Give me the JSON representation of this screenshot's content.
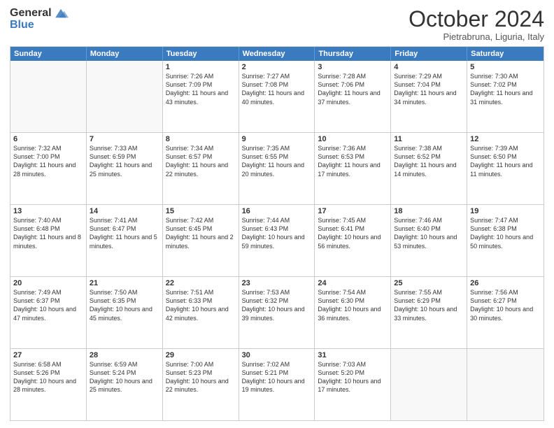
{
  "header": {
    "logo_general": "General",
    "logo_blue": "Blue",
    "title": "October 2024",
    "location": "Pietrabruna, Liguria, Italy"
  },
  "days_of_week": [
    "Sunday",
    "Monday",
    "Tuesday",
    "Wednesday",
    "Thursday",
    "Friday",
    "Saturday"
  ],
  "weeks": [
    [
      {
        "day": "",
        "text": ""
      },
      {
        "day": "",
        "text": ""
      },
      {
        "day": "1",
        "text": "Sunrise: 7:26 AM\nSunset: 7:09 PM\nDaylight: 11 hours and 43 minutes."
      },
      {
        "day": "2",
        "text": "Sunrise: 7:27 AM\nSunset: 7:08 PM\nDaylight: 11 hours and 40 minutes."
      },
      {
        "day": "3",
        "text": "Sunrise: 7:28 AM\nSunset: 7:06 PM\nDaylight: 11 hours and 37 minutes."
      },
      {
        "day": "4",
        "text": "Sunrise: 7:29 AM\nSunset: 7:04 PM\nDaylight: 11 hours and 34 minutes."
      },
      {
        "day": "5",
        "text": "Sunrise: 7:30 AM\nSunset: 7:02 PM\nDaylight: 11 hours and 31 minutes."
      }
    ],
    [
      {
        "day": "6",
        "text": "Sunrise: 7:32 AM\nSunset: 7:00 PM\nDaylight: 11 hours and 28 minutes."
      },
      {
        "day": "7",
        "text": "Sunrise: 7:33 AM\nSunset: 6:59 PM\nDaylight: 11 hours and 25 minutes."
      },
      {
        "day": "8",
        "text": "Sunrise: 7:34 AM\nSunset: 6:57 PM\nDaylight: 11 hours and 22 minutes."
      },
      {
        "day": "9",
        "text": "Sunrise: 7:35 AM\nSunset: 6:55 PM\nDaylight: 11 hours and 20 minutes."
      },
      {
        "day": "10",
        "text": "Sunrise: 7:36 AM\nSunset: 6:53 PM\nDaylight: 11 hours and 17 minutes."
      },
      {
        "day": "11",
        "text": "Sunrise: 7:38 AM\nSunset: 6:52 PM\nDaylight: 11 hours and 14 minutes."
      },
      {
        "day": "12",
        "text": "Sunrise: 7:39 AM\nSunset: 6:50 PM\nDaylight: 11 hours and 11 minutes."
      }
    ],
    [
      {
        "day": "13",
        "text": "Sunrise: 7:40 AM\nSunset: 6:48 PM\nDaylight: 11 hours and 8 minutes."
      },
      {
        "day": "14",
        "text": "Sunrise: 7:41 AM\nSunset: 6:47 PM\nDaylight: 11 hours and 5 minutes."
      },
      {
        "day": "15",
        "text": "Sunrise: 7:42 AM\nSunset: 6:45 PM\nDaylight: 11 hours and 2 minutes."
      },
      {
        "day": "16",
        "text": "Sunrise: 7:44 AM\nSunset: 6:43 PM\nDaylight: 10 hours and 59 minutes."
      },
      {
        "day": "17",
        "text": "Sunrise: 7:45 AM\nSunset: 6:41 PM\nDaylight: 10 hours and 56 minutes."
      },
      {
        "day": "18",
        "text": "Sunrise: 7:46 AM\nSunset: 6:40 PM\nDaylight: 10 hours and 53 minutes."
      },
      {
        "day": "19",
        "text": "Sunrise: 7:47 AM\nSunset: 6:38 PM\nDaylight: 10 hours and 50 minutes."
      }
    ],
    [
      {
        "day": "20",
        "text": "Sunrise: 7:49 AM\nSunset: 6:37 PM\nDaylight: 10 hours and 47 minutes."
      },
      {
        "day": "21",
        "text": "Sunrise: 7:50 AM\nSunset: 6:35 PM\nDaylight: 10 hours and 45 minutes."
      },
      {
        "day": "22",
        "text": "Sunrise: 7:51 AM\nSunset: 6:33 PM\nDaylight: 10 hours and 42 minutes."
      },
      {
        "day": "23",
        "text": "Sunrise: 7:53 AM\nSunset: 6:32 PM\nDaylight: 10 hours and 39 minutes."
      },
      {
        "day": "24",
        "text": "Sunrise: 7:54 AM\nSunset: 6:30 PM\nDaylight: 10 hours and 36 minutes."
      },
      {
        "day": "25",
        "text": "Sunrise: 7:55 AM\nSunset: 6:29 PM\nDaylight: 10 hours and 33 minutes."
      },
      {
        "day": "26",
        "text": "Sunrise: 7:56 AM\nSunset: 6:27 PM\nDaylight: 10 hours and 30 minutes."
      }
    ],
    [
      {
        "day": "27",
        "text": "Sunrise: 6:58 AM\nSunset: 5:26 PM\nDaylight: 10 hours and 28 minutes."
      },
      {
        "day": "28",
        "text": "Sunrise: 6:59 AM\nSunset: 5:24 PM\nDaylight: 10 hours and 25 minutes."
      },
      {
        "day": "29",
        "text": "Sunrise: 7:00 AM\nSunset: 5:23 PM\nDaylight: 10 hours and 22 minutes."
      },
      {
        "day": "30",
        "text": "Sunrise: 7:02 AM\nSunset: 5:21 PM\nDaylight: 10 hours and 19 minutes."
      },
      {
        "day": "31",
        "text": "Sunrise: 7:03 AM\nSunset: 5:20 PM\nDaylight: 10 hours and 17 minutes."
      },
      {
        "day": "",
        "text": ""
      },
      {
        "day": "",
        "text": ""
      }
    ]
  ]
}
